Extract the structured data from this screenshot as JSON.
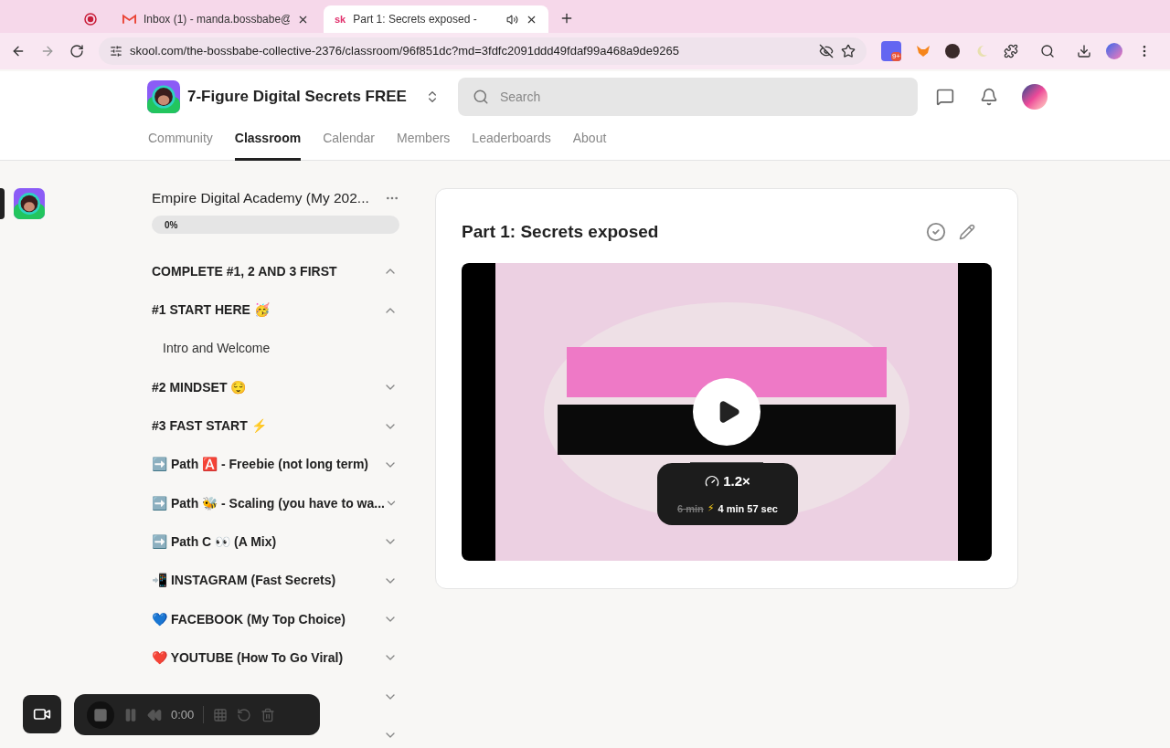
{
  "browser": {
    "tabs": [
      {
        "kind": "recording",
        "selected": false
      },
      {
        "kind": "mail",
        "title": "Inbox (1) - manda.bossbabe@",
        "selected": false
      },
      {
        "kind": "site",
        "favicon": "sk",
        "title": "Part 1: Secrets exposed -",
        "audio": true,
        "selected": true
      }
    ],
    "url": "skool.com/the-bossbabe-collective-2376/classroom/96f851dc?md=3fdfc2091ddd49fdaf99a468a9de9265",
    "extension_badge": "9+"
  },
  "header": {
    "group_name": "7-Figure Digital Secrets FREE",
    "search": {
      "placeholder": "Search"
    },
    "nav": [
      {
        "label": "Community",
        "selected": false
      },
      {
        "label": "Classroom",
        "selected": true
      },
      {
        "label": "Calendar",
        "selected": false
      },
      {
        "label": "Members",
        "selected": false
      },
      {
        "label": "Leaderboards",
        "selected": false
      },
      {
        "label": "About",
        "selected": false
      }
    ]
  },
  "course": {
    "title": "Empire Digital Academy (My 202...",
    "progress": {
      "level": 0,
      "reading": "0%"
    },
    "items": [
      {
        "kind": "section",
        "label": "COMPLETE #1, 2 AND 3 FIRST",
        "expanded": true
      },
      {
        "kind": "section",
        "label": "#1 START HERE 🥳",
        "expanded": true
      },
      {
        "kind": "lesson",
        "label": "Intro and Welcome"
      },
      {
        "kind": "section",
        "label": "#2 MINDSET 😌",
        "expanded": false
      },
      {
        "kind": "section",
        "label": "#3 FAST START ⚡",
        "expanded": false
      },
      {
        "kind": "section",
        "label": "➡️ Path 🅰️ - Freebie (not long term)",
        "expanded": false
      },
      {
        "kind": "section",
        "label": "➡️ Path 🐝 - Scaling (you have to wa...",
        "expanded": false
      },
      {
        "kind": "section",
        "label": "➡️ Path C 👀 (A Mix)",
        "expanded": false
      },
      {
        "kind": "section",
        "label": "📲 INSTAGRAM (Fast Secrets)",
        "expanded": false
      },
      {
        "kind": "section",
        "label": "💙 FACEBOOK (My Top Choice)",
        "expanded": false
      },
      {
        "kind": "section",
        "label": "❤️ YOUTUBE (How To Go Viral)",
        "expanded": false
      },
      {
        "kind": "section",
        "expanded": false
      },
      {
        "kind": "section",
        "expanded": false
      }
    ]
  },
  "lesson": {
    "title": "Part 1: Secrets exposed",
    "completed": false,
    "video": {
      "kind": "picture",
      "speed": "1.2×",
      "original_duration": "6 min",
      "fast_icon": "⚡",
      "fast_duration": "4 min 57 sec"
    }
  },
  "recorder": {
    "time": "0:00"
  }
}
